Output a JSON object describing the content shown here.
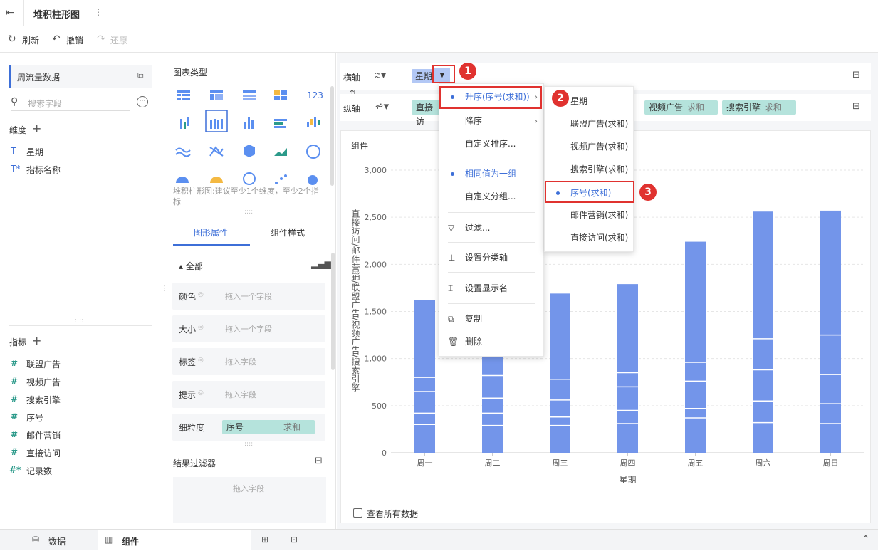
{
  "header": {
    "title": "堆积柱形图",
    "more": "⋮"
  },
  "toolbar": {
    "refresh": "刷新",
    "undo": "撤销",
    "redo": "还原"
  },
  "left": {
    "dataset": "周流量数据",
    "search_placeholder": "搜索字段",
    "dim_title": "维度",
    "dims": [
      "星期",
      "指标名称"
    ],
    "metric_title": "指标",
    "metrics": [
      "联盟广告",
      "视频广告",
      "搜索引擎",
      "序号",
      "邮件营销",
      "直接访问",
      "记录数"
    ]
  },
  "mid": {
    "chart_type_title": "图表类型",
    "tip": "堆积柱形图:建议至少1个维度，至少2个指标",
    "tab_props": "图形属性",
    "tab_style": "组件样式",
    "all": "全部",
    "color": "颜色",
    "size": "大小",
    "label": "标签",
    "hint": "提示",
    "grain": "细粒度",
    "drag_one": "拖入一个字段",
    "drag": "拖入字段",
    "grain_field": "序号",
    "grain_agg": "求和",
    "result_filter": "结果过滤器",
    "drag_field": "拖入字段"
  },
  "axes": {
    "x_label": "横轴",
    "y_label": "纵轴",
    "x_field": "星期",
    "y_fields": [
      {
        "name": "直接访",
        "agg": ""
      },
      {
        "name": "视频广告",
        "agg": "求和"
      },
      {
        "name": "搜索引擎",
        "agg": "求和"
      }
    ]
  },
  "component": {
    "title": "组件",
    "view_all": "查看所有数据"
  },
  "menu1": {
    "asc": "升序(序号(求和))",
    "desc": "降序",
    "custom_sort": "自定义排序...",
    "same_group": "相同值为一组",
    "custom_group": "自定义分组...",
    "filter": "过滤...",
    "set_axis": "设置分类轴",
    "set_name": "设置显示名",
    "copy": "复制",
    "delete": "删除"
  },
  "menu2": {
    "items": [
      "星期",
      "联盟广告(求和)",
      "视频广告(求和)",
      "搜索引擎(求和)",
      "序号(求和)",
      "邮件营销(求和)",
      "直接访问(求和)"
    ]
  },
  "badges": [
    "1",
    "2",
    "3"
  ],
  "footer": {
    "data": "数据",
    "component": "组件"
  },
  "chart_data": {
    "type": "bar",
    "stacked": true,
    "categories": [
      "周一",
      "周二",
      "周三",
      "周四",
      "周五",
      "周六",
      "周日"
    ],
    "totals": [
      1620,
      1050,
      1690,
      1790,
      2240,
      2560,
      2570
    ],
    "segment_bounds": [
      [
        300,
        420,
        650,
        800
      ],
      [
        290,
        420,
        580,
        820
      ],
      [
        290,
        380,
        560,
        780
      ],
      [
        310,
        450,
        700,
        850
      ],
      [
        370,
        470,
        760,
        960
      ],
      [
        320,
        550,
        880,
        1210
      ],
      [
        310,
        520,
        830,
        1250
      ]
    ],
    "ylabel": "直接访问/邮件营销/联盟广告/视频广告/搜索引擎",
    "xlabel": "星期",
    "ylim": [
      0,
      3000
    ],
    "yticks": [
      "3,000",
      "2,500",
      "2,000",
      "1,500",
      "1,000",
      "500",
      "0"
    ],
    "color": "#7395ea"
  }
}
